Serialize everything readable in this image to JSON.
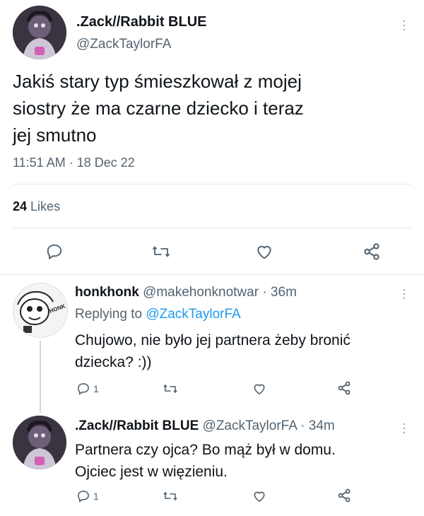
{
  "main_tweet": {
    "display_name": ".Zack//Rabbit BLUE",
    "handle": "@ZackTaylorFA",
    "text_lines": [
      "Jakiś stary typ śmieszkował z mojej",
      "siostry że ma czarne dziecko i teraz",
      "jej smutno"
    ],
    "timestamp": "11:51 AM · 18 Dec 22",
    "likes_count": "24",
    "likes_label": "Likes"
  },
  "replies": [
    {
      "display_name": "honkhonk",
      "handle": "@makehonknotwar",
      "time": "· 36m",
      "replying_prefix": "Replying to",
      "replying_to": "@ZackTaylorFA",
      "text_lines": [
        "Chujowo, nie było jej partnera żeby bronić",
        "dziecka? :))"
      ],
      "reply_count": "1",
      "avatar_text": "HONK HONK"
    },
    {
      "display_name": ".Zack//Rabbit BLUE",
      "handle": "@ZackTaylorFA",
      "time": "· 34m",
      "text_lines": [
        "Partnera czy ojca? Bo mąż był w domu.",
        "Ojciec jest w więzieniu."
      ],
      "reply_count": "1"
    }
  ],
  "icons": [
    "more-icon",
    "reply-icon",
    "retweet-icon",
    "like-icon",
    "share-icon"
  ],
  "colors": {
    "text": "#0f1419",
    "muted": "#536471",
    "link": "#1d9bf0",
    "divider": "#e3e8ec"
  }
}
